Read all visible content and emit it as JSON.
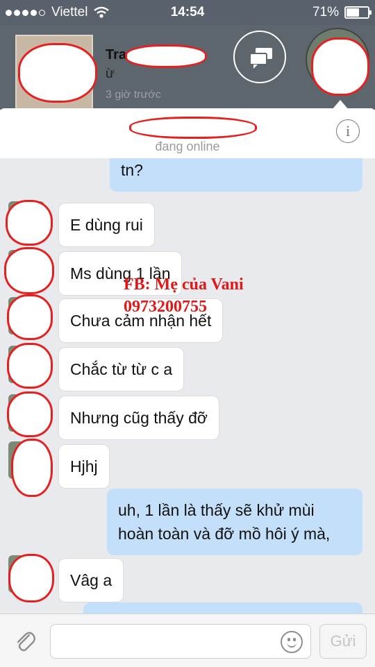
{
  "status_bar": {
    "carrier": "Viettel",
    "time": "14:54",
    "battery": "71%",
    "battery_level": 0.71
  },
  "chat_head": {
    "name": "Tra",
    "preview": "ừ",
    "time": "3 giờ trước"
  },
  "conversation": {
    "status": "đang online",
    "partial_top_text": "tn?"
  },
  "messages": [
    {
      "dir": "in",
      "text": "E dùng rui"
    },
    {
      "dir": "in",
      "text": "Ms dùng 1 lần"
    },
    {
      "dir": "in",
      "text": "Chưa cảm nhận hết"
    },
    {
      "dir": "in",
      "text": "Chắc từ từ c a"
    },
    {
      "dir": "in",
      "text": "Nhưng cũg thấy đỡ"
    },
    {
      "dir": "in",
      "text": "Hjhj"
    },
    {
      "dir": "out",
      "line1": "uh, 1 lần là thấy sẽ khử mùi",
      "line2": "hoàn toàn và đỡ mồ hôi ý mà,"
    },
    {
      "dir": "in",
      "text": "Vâg a"
    }
  ],
  "watermark": {
    "line1": "FB: Mẹ của Vani",
    "line2": "0973200755"
  },
  "composer": {
    "send_label": "Gửi"
  },
  "icons": [
    "wifi-icon",
    "battery-icon",
    "chat-bubbles-icon",
    "info-icon",
    "paperclip-icon",
    "emoji-icon"
  ]
}
